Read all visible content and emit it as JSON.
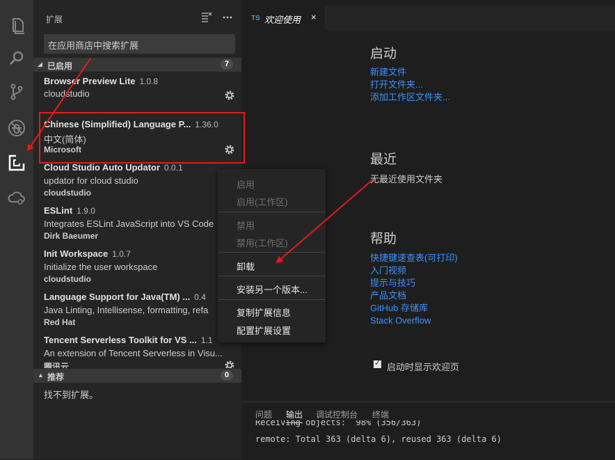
{
  "sidebar": {
    "title": "扩展",
    "search_placeholder": "在应用商店中搜索扩展",
    "enabled_header": "已启用",
    "enabled_count": "7",
    "extensions": [
      {
        "name": "Browser Preview Lite",
        "version": "1.0.8",
        "description": "",
        "publisher": "cloudstudio"
      },
      {
        "name": "Chinese (Simplified) Language P...",
        "version": "1.36.0",
        "description": "中文(简体)",
        "publisher": "Microsoft"
      },
      {
        "name": "Cloud Studio Auto Updator",
        "version": "0.0.1",
        "description": "updator for cloud studio",
        "publisher": "cloudstudio"
      },
      {
        "name": "ESLint",
        "version": "1.9.0",
        "description": "Integrates ESLint JavaScript into VS Code",
        "publisher": "Dirk Baeumer"
      },
      {
        "name": "Init Workspace",
        "version": "1.0.7",
        "description": "Initialize the user workspace",
        "publisher": "cloudstudio"
      },
      {
        "name": "Language Support for Java(TM) ...",
        "version": "0.4",
        "description": "Java Linting, Intellisense, formatting, refa",
        "publisher": "Red Hat"
      },
      {
        "name": "Tencent Serverless Toolkit for VS ...",
        "version": "1.1",
        "description": "An extension of Tencent Serverless in Visu...",
        "publisher": "腾讯云"
      }
    ],
    "recommended_header": "推荐",
    "recommended_count": "0",
    "recommended_empty": "找不到扩展。"
  },
  "tab": {
    "lang": "TS",
    "title": "欢迎使用",
    "close": "×"
  },
  "welcome": {
    "start_heading": "启动",
    "start_links": [
      "新建文件",
      "打开文件夹...",
      "添加工作区文件夹..."
    ],
    "recent_heading": "最近",
    "recent_empty": "无最近使用文件夹",
    "help_heading": "帮助",
    "help_links": [
      "快捷键速查表(可打印)",
      "入门视频",
      "提示与技巧",
      "产品文档",
      "GitHub 存储库",
      "Stack Overflow"
    ],
    "show_on_startup": "启动时显示欢迎页"
  },
  "panel": {
    "tabs": [
      "问题",
      "输出",
      "调试控制台",
      "终端"
    ],
    "active_tab": "输出",
    "lines": [
      "Receiving objects:  98% (356/363)",
      "remote: Total 363 (delta 6), reused 363 (delta 6)"
    ]
  },
  "context_menu": {
    "enable": "启用",
    "enable_workspace": "启用(工作区)",
    "disable": "禁用",
    "disable_workspace": "禁用(工作区)",
    "uninstall": "卸载",
    "install_another": "安装另一个版本...",
    "copy_info": "复制扩展信息",
    "configure": "配置扩展设置"
  },
  "colors": {
    "accent_link": "#3794ff",
    "annotation_red": "#e51a1a"
  }
}
